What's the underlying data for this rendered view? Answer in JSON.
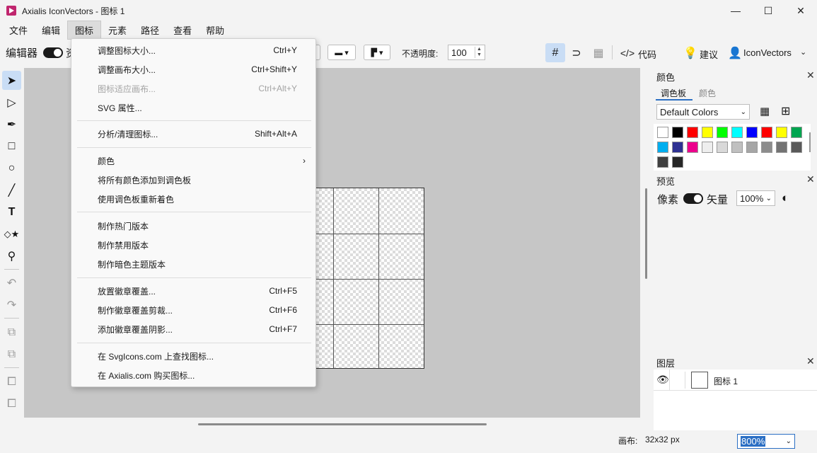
{
  "window": {
    "title": "Axialis IconVectors - 图标 1",
    "minimize": "—",
    "maximize": "☐",
    "close": "✕"
  },
  "menubar": [
    "文件",
    "编辑",
    "图标",
    "元素",
    "路径",
    "查看",
    "帮助"
  ],
  "toolbar": {
    "editor_label": "编辑器",
    "editor_suffix": "资",
    "opacity_label": "不透明度:",
    "opacity_value": "100",
    "code_label": "代码",
    "suggest_label": "建议",
    "account_label": "IconVectors"
  },
  "icon_menu": {
    "items": [
      {
        "label": "调整图标大小...",
        "shortcut": "Ctrl+Y",
        "enabled": true
      },
      {
        "label": "调整画布大小...",
        "shortcut": "Ctrl+Shift+Y",
        "enabled": true
      },
      {
        "label": "图标适应画布...",
        "shortcut": "Ctrl+Alt+Y",
        "enabled": false
      },
      {
        "label": "SVG 属性...",
        "shortcut": "",
        "enabled": true
      },
      {
        "label": "分析/清理图标...",
        "shortcut": "Shift+Alt+A",
        "enabled": true
      },
      {
        "label": "颜色",
        "shortcut": "",
        "enabled": true,
        "submenu": true
      },
      {
        "label": "将所有颜色添加到调色板",
        "shortcut": "",
        "enabled": true
      },
      {
        "label": "使用调色板重新着色",
        "shortcut": "",
        "enabled": true
      },
      {
        "label": "制作热门版本",
        "shortcut": "",
        "enabled": true
      },
      {
        "label": "制作禁用版本",
        "shortcut": "",
        "enabled": true
      },
      {
        "label": "制作暗色主题版本",
        "shortcut": "",
        "enabled": true
      },
      {
        "label": "放置徽章覆盖...",
        "shortcut": "Ctrl+F5",
        "enabled": true
      },
      {
        "label": "制作徽章覆盖剪裁...",
        "shortcut": "Ctrl+F6",
        "enabled": true
      },
      {
        "label": "添加徽章覆盖阴影...",
        "shortcut": "Ctrl+F7",
        "enabled": true
      },
      {
        "label": "在 SvgIcons.com 上查找图标...",
        "shortcut": "",
        "enabled": true
      },
      {
        "label": "在 Axialis.com 购买图标...",
        "shortcut": "",
        "enabled": true
      }
    ]
  },
  "colors_panel": {
    "title": "颜色",
    "tabs": [
      "调色板",
      "颜色"
    ],
    "palette_select": "Default Colors",
    "swatches": [
      "#ffffff",
      "#000000",
      "#ff0000",
      "#ffff00",
      "#00ff00",
      "#00ffff",
      "#0000ff",
      "#ff0000",
      "#ffff00",
      "#00a550",
      "#00aeef",
      "#2e3192",
      "#ec008c",
      "#eeeeee",
      "#d9d9d9",
      "#c0c0c0",
      "#a6a6a6",
      "#8c8c8c",
      "#737373",
      "#595959",
      "#404040",
      "#262626"
    ]
  },
  "preview_panel": {
    "title": "预览",
    "pixel_label": "像素",
    "vector_label": "矢量",
    "zoom_value": "100%"
  },
  "layers_panel": {
    "title": "图层",
    "layer_name": "图标 1"
  },
  "status": {
    "canvas_label": "画布:",
    "canvas_size": "32x32 px",
    "zoom": "800%"
  }
}
